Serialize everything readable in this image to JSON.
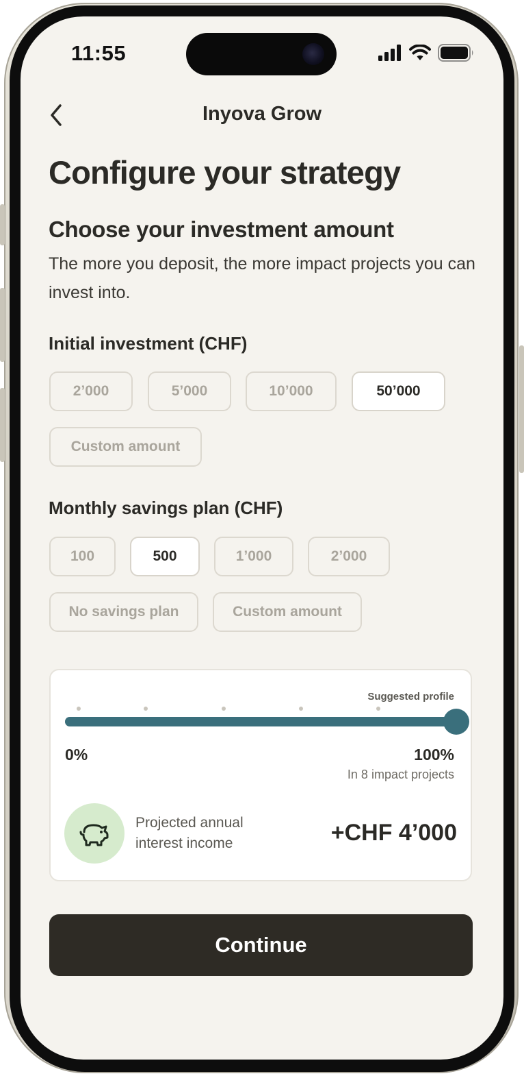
{
  "status_bar": {
    "time": "11:55"
  },
  "nav": {
    "title": "Inyova Grow"
  },
  "page": {
    "title": "Configure your strategy",
    "subtitle": "Choose your investment amount",
    "description": "The more you deposit, the more impact projects you can invest into."
  },
  "initial_investment": {
    "label": "Initial investment (CHF)",
    "options": [
      "2’000",
      "5’000",
      "10’000",
      "50’000",
      "Custom amount"
    ],
    "selected": "50’000"
  },
  "monthly_savings": {
    "label": "Monthly savings plan (CHF)",
    "options": [
      "100",
      "500",
      "1’000",
      "2’000",
      "No savings plan",
      "Custom amount"
    ],
    "selected": "500"
  },
  "allocation_card": {
    "suggested_label": "Suggested profile",
    "slider_value_percent": 100,
    "min_label": "0%",
    "max_label": "100%",
    "projects_text": "In 8 impact projects",
    "income_label": "Projected annual interest income",
    "income_value": "+CHF 4’000"
  },
  "continue_label": "Continue",
  "colors": {
    "background": "#f5f3ee",
    "accent": "#3a6f7c",
    "primary_button": "#2e2b25",
    "icon_bg": "#d6ebcd"
  }
}
